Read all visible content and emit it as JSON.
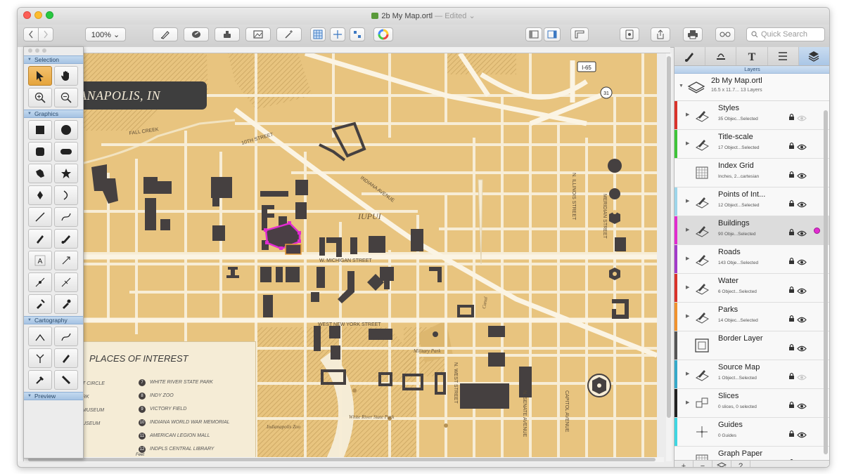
{
  "window": {
    "title": "2b My Map.ortl",
    "title_suffix": "— Edited ⌄",
    "traffic_colors": [
      "#fc5f57",
      "#fdbc2e",
      "#28c840"
    ]
  },
  "toolbar": {
    "zoom": "100% ⌄",
    "search_placeholder": "Quick Search"
  },
  "map": {
    "city_label": "ANAPOLIS, IN",
    "streets": {
      "fall_creek": "FALL CREEK",
      "tenth": "10TH STREET",
      "indiana_ave": "INDIANA AVENUE",
      "michigan": "W. MICHIGAN STREET",
      "new_york": "WEST NEW YORK STREET",
      "west_st": "N. WEST STREET",
      "senate": "N. SENATE AVENUE",
      "capitol": "CAPITOL AVENUE",
      "illinois": "N. ILLINOIS STREET",
      "meridian": "MERIDIAN STREET"
    },
    "labels": {
      "iupui": "IUPUI",
      "canal": "Canal",
      "military_park": "Military Park",
      "white_river": "White River State Park",
      "zoo": "Indianapolis Zoo"
    },
    "shields": {
      "i65": "I-65",
      "us31": "31"
    },
    "poi": {
      "title": "PLACES OF INTEREST",
      "left_items": [
        "T CIRCLE",
        "RK",
        "MUSEUM",
        "USEUM"
      ],
      "right_items": [
        {
          "num": "7",
          "text": "WHITE RIVER STATE PARK"
        },
        {
          "num": "8",
          "text": "INDY ZOO"
        },
        {
          "num": "9",
          "text": "VICTORY FIELD"
        },
        {
          "num": "10",
          "text": "INDIANA WORLD WAR MEMORIAL"
        },
        {
          "num": "11",
          "text": "AMERICAN LEGION MALL"
        },
        {
          "num": "12",
          "text": "INDPLS CENTRAL LIBRARY"
        }
      ],
      "footer": "Feet"
    }
  },
  "palette": {
    "sections": [
      "Selection",
      "Graphics",
      "Cartography",
      "Preview"
    ]
  },
  "panel": {
    "section_label": "Layers",
    "document": {
      "name": "2b My Map.ortl",
      "sub": "16.5 x 11.7... 13 Layers"
    },
    "layers": [
      {
        "name": "Styles",
        "sub": "35 Objec...Selected",
        "color": "#d9332b",
        "icon": "pen",
        "disclosure": true,
        "eye_dim": true
      },
      {
        "name": "Title-scale",
        "sub": "17 Object...Selected",
        "color": "#3ec43a",
        "icon": "pen",
        "disclosure": true,
        "eye_dim": false
      },
      {
        "name": "Index Grid",
        "sub": "Inches, 2...cartesian",
        "color": "",
        "icon": "grid",
        "disclosure": false,
        "eye_dim": false
      },
      {
        "name": "Points of Int...",
        "sub": "12 Object...Selected",
        "color": "#9dd5ea",
        "icon": "pen",
        "disclosure": true,
        "eye_dim": false
      },
      {
        "name": "Buildings",
        "sub": "90 Obje...Selected",
        "color": "#e12cd0",
        "icon": "pen",
        "disclosure": true,
        "eye_dim": false,
        "selected": true
      },
      {
        "name": "Roads",
        "sub": "143 Obje...Selected",
        "color": "#a33bc9",
        "icon": "pen",
        "disclosure": true,
        "eye_dim": false
      },
      {
        "name": "Water",
        "sub": "6 Object...Selected",
        "color": "#d9332b",
        "icon": "pen",
        "disclosure": true,
        "eye_dim": false
      },
      {
        "name": "Parks",
        "sub": "14 Objec...Selected",
        "color": "#f0922d",
        "icon": "pen",
        "disclosure": true,
        "eye_dim": false
      },
      {
        "name": "Border Layer",
        "sub": "",
        "color": "#555555",
        "icon": "square",
        "disclosure": false,
        "eye_dim": false
      },
      {
        "name": "Source Map",
        "sub": "1 Object...Selected",
        "color": "#35a9c9",
        "icon": "pen",
        "disclosure": true,
        "eye_dim": true
      },
      {
        "name": "Slices",
        "sub": "0 slices, 0 selected",
        "color": "#222222",
        "icon": "slices",
        "disclosure": true,
        "eye_dim": false
      },
      {
        "name": "Guides",
        "sub": "0 Guides",
        "color": "#3fd6e2",
        "icon": "guides",
        "disclosure": false,
        "eye_dim": false
      },
      {
        "name": "Graph Paper",
        "sub": "Inches, 5...artesian",
        "color": "",
        "icon": "grid",
        "disclosure": false,
        "eye_dim": false
      }
    ],
    "footer": [
      "+",
      "−",
      "layers-icon",
      "?"
    ]
  }
}
